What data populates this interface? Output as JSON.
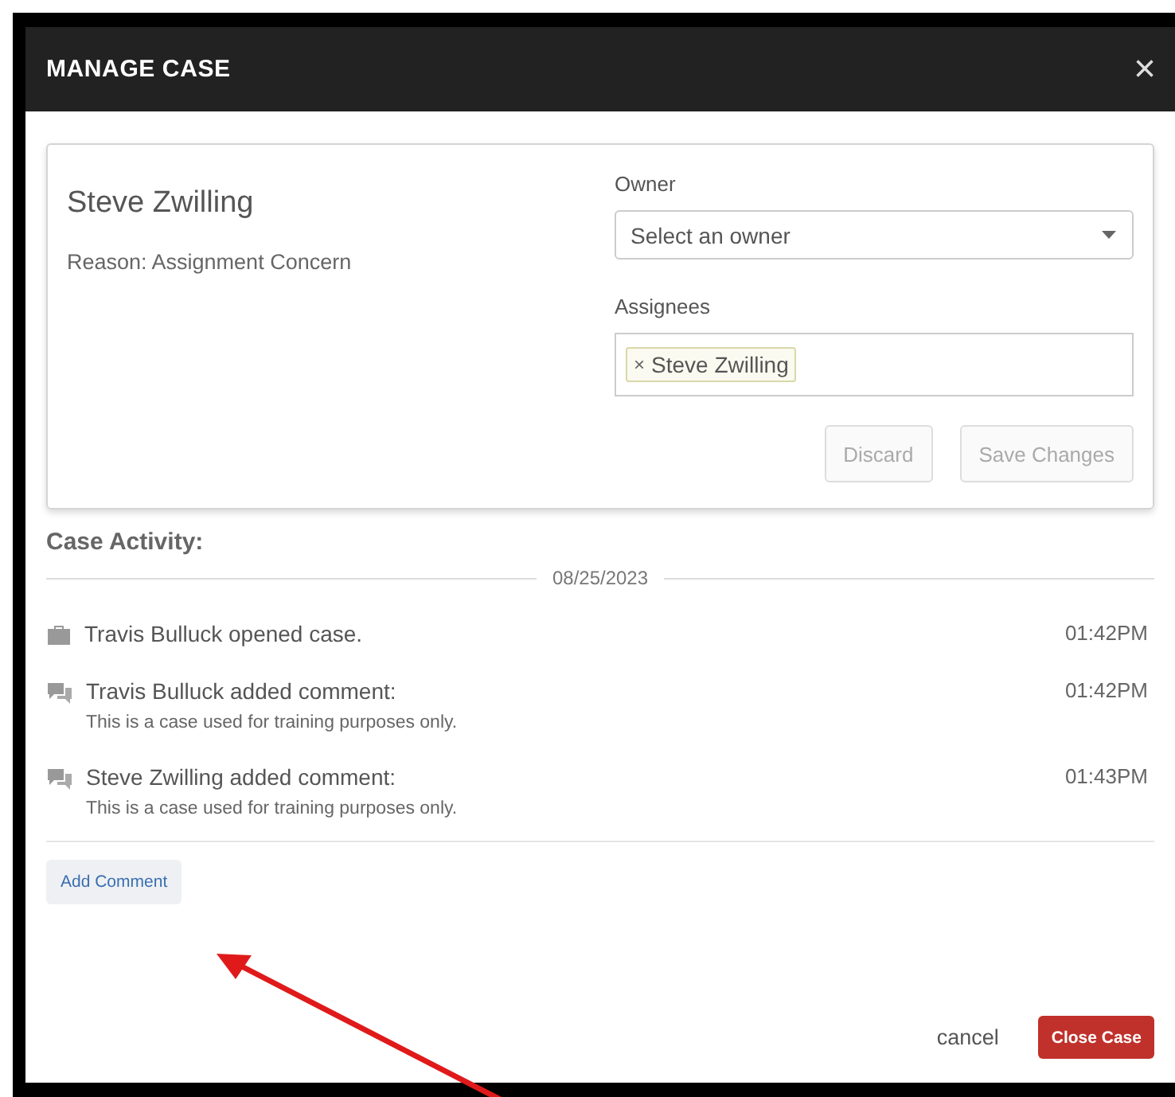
{
  "dialog": {
    "title": "MANAGE CASE",
    "close_icon": "×"
  },
  "case": {
    "name": "Steve Zwilling",
    "reason": "Reason: Assignment Concern"
  },
  "owner": {
    "label": "Owner",
    "placeholder": "Select an owner"
  },
  "assignees": {
    "label": "Assignees",
    "tags": [
      {
        "remove": "×",
        "name": "Steve Zwilling"
      }
    ]
  },
  "card_buttons": [
    {
      "label": "Discard",
      "disabled": true
    },
    {
      "label": "Save Changes",
      "disabled": true
    }
  ],
  "activity": {
    "heading": "Case Activity:",
    "date": "08/25/2023",
    "items": [
      {
        "kind": "opened",
        "text": "Travis Bulluck opened case.",
        "time": "01:42PM"
      },
      {
        "kind": "comment",
        "text": "Travis Bulluck added comment:",
        "body": "This is a case used for training purposes only.",
        "time": "01:42PM"
      },
      {
        "kind": "comment",
        "text": "Steve Zwilling added comment:",
        "body": "This is a case used for training purposes only.",
        "time": "01:43PM"
      }
    ]
  },
  "add_comment": "Add Comment",
  "footer": {
    "cancel": "cancel",
    "close_case": "Close Case"
  }
}
